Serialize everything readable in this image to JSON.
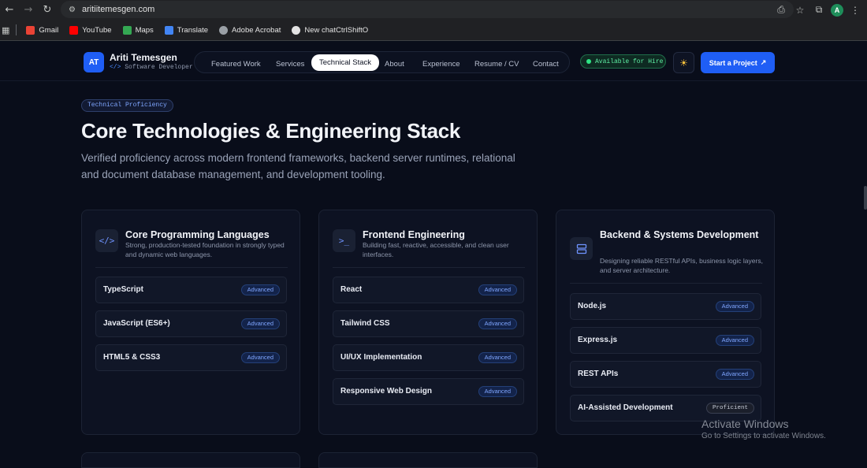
{
  "browser": {
    "url": "aritiitemesgen.com",
    "profile_initial": "A",
    "bookmarks": [
      {
        "label": "Gmail",
        "color": "#ea4335"
      },
      {
        "label": "YouTube",
        "color": "#ff0000"
      },
      {
        "label": "Maps",
        "color": "#34a853"
      },
      {
        "label": "Translate",
        "color": "#4285f4"
      },
      {
        "label": "Adobe Acrobat",
        "color": "#9aa0a6"
      },
      {
        "label": "New chatCtrlShiftO",
        "color": "#e3e3e3"
      }
    ]
  },
  "header": {
    "logo_initials": "AT",
    "name": "Ariti Temesgen",
    "role_icon": "</>",
    "role": "Software Developer",
    "nav": [
      "Featured Work",
      "Services",
      "Technical Stack",
      "About",
      "Experience",
      "Resume / CV",
      "Contact"
    ],
    "active_nav": "Technical Stack",
    "hire_label": "Available for Hire",
    "cta_label": "Start a Project",
    "cta_arrow": "↗"
  },
  "section": {
    "badge": "Technical Proficiency",
    "title": "Core Technologies & Engineering Stack",
    "lead": "Verified proficiency across modern frontend frameworks, backend server runtimes, relational and document database management, and development tooling."
  },
  "cards": [
    {
      "icon": "</>",
      "title": "Core Programming Languages",
      "desc": "Strong, production-tested foundation in strongly typed and dynamic web languages.",
      "skills": [
        {
          "name": "TypeScript",
          "level": "Advanced"
        },
        {
          "name": "JavaScript (ES6+)",
          "level": "Advanced"
        },
        {
          "name": "HTML5 & CSS3",
          "level": "Advanced"
        }
      ]
    },
    {
      "icon": ">_",
      "title": "Frontend Engineering",
      "desc": "Building fast, reactive, accessible, and clean user interfaces.",
      "skills": [
        {
          "name": "React",
          "level": "Advanced"
        },
        {
          "name": "Tailwind CSS",
          "level": "Advanced"
        },
        {
          "name": "UI/UX Implementation",
          "level": "Advanced"
        },
        {
          "name": "Responsive Web Design",
          "level": "Advanced"
        }
      ]
    },
    {
      "icon": "server",
      "title": "Backend & Systems Development",
      "desc": "Designing reliable RESTful APIs, business logic layers, and server architecture.",
      "skills": [
        {
          "name": "Node.js",
          "level": "Advanced"
        },
        {
          "name": "Express.js",
          "level": "Advanced"
        },
        {
          "name": "REST APIs",
          "level": "Advanced"
        },
        {
          "name": "AI-Assisted Development",
          "level": "Proficient"
        }
      ]
    }
  ],
  "watermark": {
    "title": "Activate Windows",
    "sub": "Go to Settings to activate Windows."
  }
}
